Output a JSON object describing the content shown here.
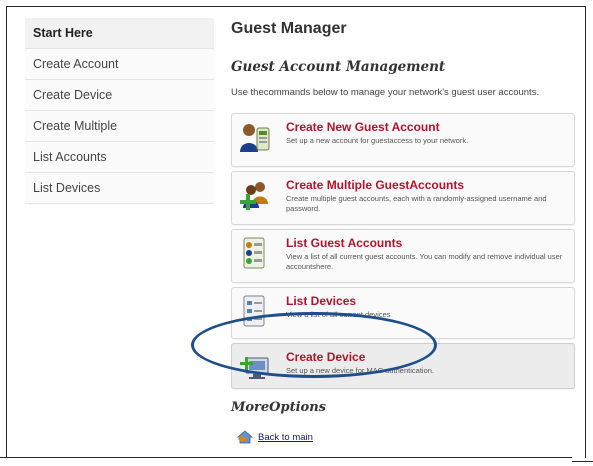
{
  "sidebar": {
    "items": [
      {
        "label": "Start Here"
      },
      {
        "label": "Create Account"
      },
      {
        "label": "Create Device"
      },
      {
        "label": "Create Multiple"
      },
      {
        "label": "List Accounts"
      },
      {
        "label": "List Devices"
      }
    ]
  },
  "main": {
    "title": "Guest Manager",
    "section_title": "Guest Account Management",
    "intro": "Use thecommands below to manage your network's guest user accounts.",
    "cards": [
      {
        "title": "Create New Guest Account",
        "description": "Set up a new account for guestaccess to your network.",
        "icon": "guest-account-icon"
      },
      {
        "title": "Create Multiple GuestAccounts",
        "description": "Create multiple guest accounts, each with a randomly-assigned username and password.",
        "icon": "multiple-accounts-icon"
      },
      {
        "title": "List Guest Accounts",
        "description": "View a list of all current guest accounts. You can modify and remove individual user accountshere.",
        "icon": "list-accounts-icon"
      },
      {
        "title": "List Devices",
        "description": "View a list of all current devices",
        "icon": "list-devices-icon"
      },
      {
        "title": "Create Device",
        "description": "Set up a new device for MAC authentication.",
        "icon": "create-device-icon"
      }
    ],
    "more_options_title": "MoreOptions",
    "back_link": "Back to main"
  },
  "colors": {
    "link_title": "#b5122b",
    "highlight_ellipse": "#1f4e8c"
  }
}
